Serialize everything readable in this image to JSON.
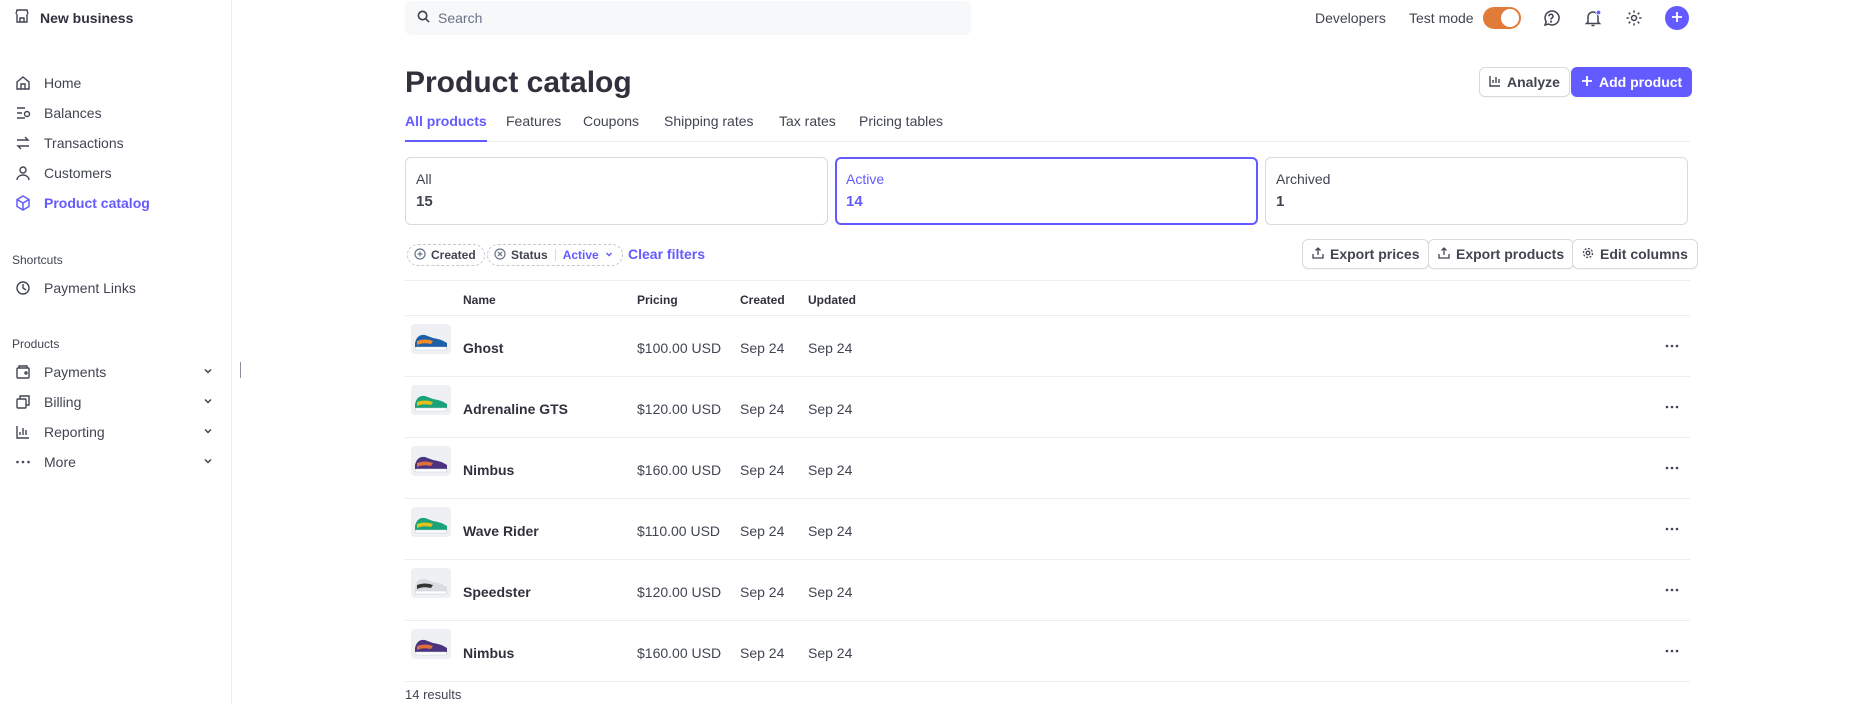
{
  "sidebar": {
    "business": "New business",
    "items": [
      {
        "label": "Home",
        "icon": "home-icon"
      },
      {
        "label": "Balances",
        "icon": "balances-icon"
      },
      {
        "label": "Transactions",
        "icon": "transactions-icon"
      },
      {
        "label": "Customers",
        "icon": "customers-icon"
      },
      {
        "label": "Product catalog",
        "icon": "product-catalog-icon",
        "active": true
      }
    ],
    "shortcuts_label": "Shortcuts",
    "shortcuts": [
      {
        "label": "Payment Links",
        "icon": "clock-icon"
      }
    ],
    "products_label": "Products",
    "products": [
      {
        "label": "Payments",
        "icon": "payments-icon"
      },
      {
        "label": "Billing",
        "icon": "billing-icon"
      },
      {
        "label": "Reporting",
        "icon": "reporting-icon"
      },
      {
        "label": "More",
        "icon": "more-icon"
      }
    ]
  },
  "topbar": {
    "search_placeholder": "Search",
    "developers": "Developers",
    "test_mode": "Test mode",
    "test_mode_on": true,
    "toggle_color": "#e07b39"
  },
  "header": {
    "title": "Product catalog",
    "analyze": "Analyze",
    "add_product": "Add product"
  },
  "tabs": [
    "All products",
    "Features",
    "Coupons",
    "Shipping rates",
    "Tax rates",
    "Pricing tables"
  ],
  "status_cards": [
    {
      "label": "All",
      "count": "15"
    },
    {
      "label": "Active",
      "count": "14",
      "selected": true
    },
    {
      "label": "Archived",
      "count": "1"
    }
  ],
  "filters": {
    "created": "Created",
    "status": "Status",
    "status_value": "Active",
    "clear": "Clear filters",
    "export_prices": "Export prices",
    "export_products": "Export products",
    "edit_columns": "Edit columns"
  },
  "table": {
    "columns": [
      "Name",
      "Pricing",
      "Created",
      "Updated"
    ],
    "rows": [
      {
        "name": "Ghost",
        "pricing": "$100.00 USD",
        "created": "Sep 24",
        "updated": "Sep 24",
        "shoe": [
          "#1f5fa8",
          "#f28c28"
        ]
      },
      {
        "name": "Adrenaline GTS",
        "pricing": "$120.00 USD",
        "created": "Sep 24",
        "updated": "Sep 24",
        "shoe": [
          "#1aa37a",
          "#e5c01a"
        ]
      },
      {
        "name": "Nimbus",
        "pricing": "$160.00 USD",
        "created": "Sep 24",
        "updated": "Sep 24",
        "shoe": [
          "#4a3480",
          "#e0703a"
        ]
      },
      {
        "name": "Wave Rider",
        "pricing": "$110.00 USD",
        "created": "Sep 24",
        "updated": "Sep 24",
        "shoe": [
          "#1aa37a",
          "#e5c01a"
        ]
      },
      {
        "name": "Speedster",
        "pricing": "$120.00 USD",
        "created": "Sep 24",
        "updated": "Sep 24",
        "shoe": [
          "#d9dde3",
          "#333333"
        ]
      },
      {
        "name": "Nimbus",
        "pricing": "$160.00 USD",
        "created": "Sep 24",
        "updated": "Sep 24",
        "shoe": [
          "#4a3480",
          "#e0703a"
        ]
      }
    ]
  },
  "results": "14 results",
  "accent_color": "#635bff"
}
